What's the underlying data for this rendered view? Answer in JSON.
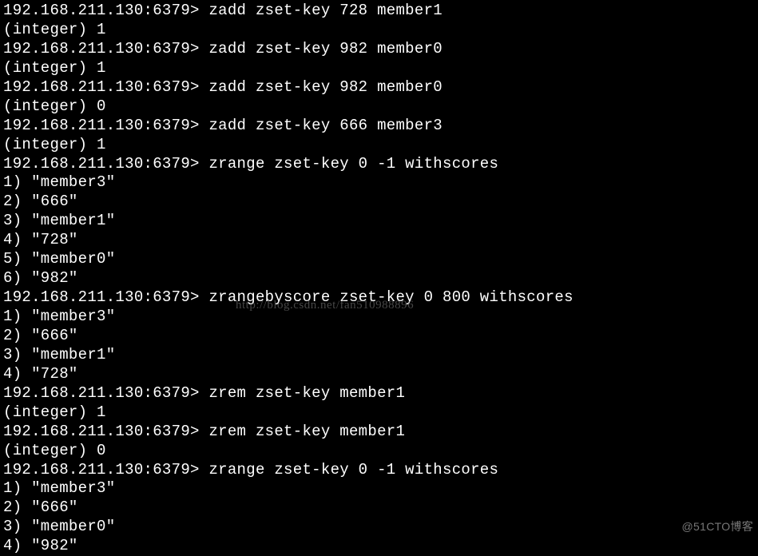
{
  "prompt": "192.168.211.130:6379> ",
  "commands": [
    {
      "cmd": "zadd zset-key 728 member1",
      "result": "(integer) 1"
    },
    {
      "cmd": "zadd zset-key 982 member0",
      "result": "(integer) 1"
    },
    {
      "cmd": "zadd zset-key 982 member0",
      "result": "(integer) 0"
    },
    {
      "cmd": "zadd zset-key 666 member3",
      "result": "(integer) 1"
    },
    {
      "cmd": "zrange zset-key 0 -1 withscores",
      "list": [
        "1) \"member3\"",
        "2) \"666\"",
        "3) \"member1\"",
        "4) \"728\"",
        "5) \"member0\"",
        "6) \"982\""
      ]
    },
    {
      "cmd": "zrangebyscore zset-key 0 800 withscores",
      "list": [
        "1) \"member3\"",
        "2) \"666\"",
        "3) \"member1\"",
        "4) \"728\""
      ]
    },
    {
      "cmd": "zrem zset-key member1",
      "result": "(integer) 1"
    },
    {
      "cmd": "zrem zset-key member1",
      "result": "(integer) 0"
    },
    {
      "cmd": "zrange zset-key 0 -1 withscores",
      "list": [
        "1) \"member3\"",
        "2) \"666\"",
        "3) \"member0\"",
        "4) \"982\""
      ]
    }
  ],
  "watermark_center": "http://blog.csdn.net/fan510988896",
  "watermark_bottom": "@51CTO博客"
}
